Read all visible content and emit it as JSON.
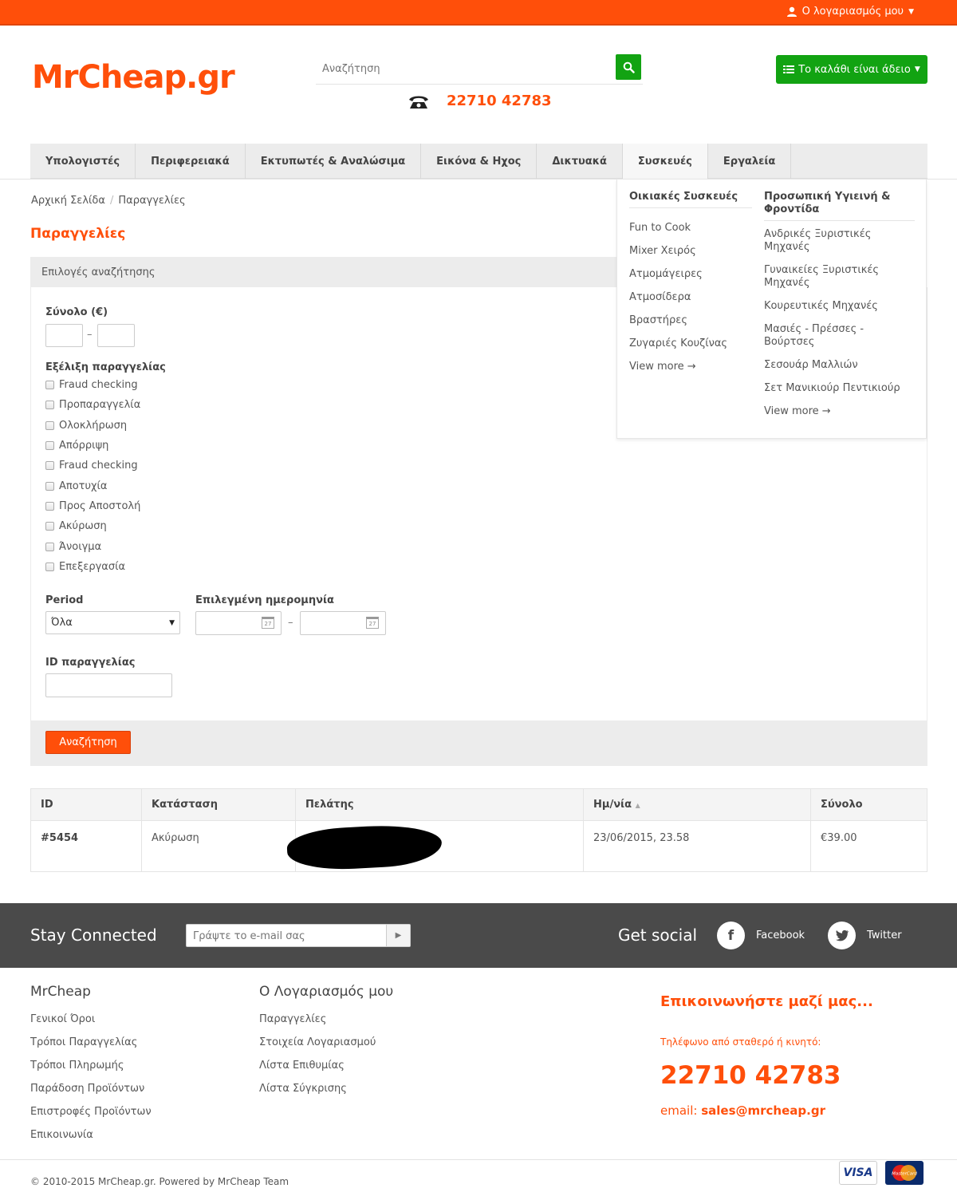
{
  "topbar": {
    "account_label": "Ο λογαριασμός μου"
  },
  "header": {
    "logo": "MrCheap.gr",
    "search_placeholder": "Αναζήτηση",
    "phone": "22710 42783",
    "cart_label": "Το καλάθι είναι άδειο"
  },
  "nav": {
    "items": [
      "Υπολογιστές",
      "Περιφερειακά",
      "Εκτυπωτές & Αναλώσιμα",
      "Εικόνα & Ηχος",
      "Δικτυακά",
      "Συσκευές",
      "Εργαλεία"
    ]
  },
  "dropdown": {
    "col1": {
      "heading": "Οικιακές Συσκευές",
      "links": [
        "Fun to Cook",
        "Mixer Χειρός",
        "Ατμομάγειρες",
        "Ατμοσίδερα",
        "Βραστήρες",
        "Ζυγαριές Κουζίνας"
      ],
      "more": "View more →"
    },
    "col2": {
      "heading": "Προσωπική Υγιεινή & Φροντίδα",
      "links": [
        "Ανδρικές Ξυριστικές Μηχανές",
        "Γυναικείες Ξυριστικές Μηχανές",
        "Κουρευτικές Μηχανές",
        "Μασιές - Πρέσσες - Βούρτσες",
        "Σεσουάρ Μαλλιών",
        "Σετ Μανικιούρ Πεντικιούρ"
      ],
      "more": "View more →"
    }
  },
  "breadcrumb": {
    "home": "Αρχική Σελίδα",
    "separator": "/",
    "current": "Παραγγελίες"
  },
  "page_title": "Παραγγελίες",
  "search_options": {
    "heading": "Επιλογές αναζήτησης",
    "total_label": "Σύνολο (€)",
    "range_sep": "–",
    "status_label": "Εξέλιξη παραγγελίας",
    "statuses": [
      "Fraud checking",
      "Προπαραγγελία",
      "Ολοκλήρωση",
      "Απόρριψη",
      "Fraud checking",
      "Αποτυχία",
      "Προς Αποστολή",
      "Ακύρωση",
      "Άνοιγμα",
      "Επεξεργασία"
    ],
    "period_label": "Period",
    "period_value": "Όλα",
    "date_label": "Επιλεγμένη ημερομηνία",
    "date_sep": "–",
    "calendar_day": "27",
    "order_id_label": "ID παραγγελίας",
    "submit_label": "Αναζήτηση"
  },
  "table": {
    "headers": [
      "ID",
      "Κατάσταση",
      "Πελάτης",
      "Ημ/νία",
      "Σύνολο"
    ],
    "sort_indicator": "▲",
    "rows": [
      {
        "id": "#5454",
        "status": "Ακύρωση",
        "customer": "",
        "date": "23/06/2015, 23.58",
        "total": "€39.00"
      }
    ]
  },
  "stay_connected": {
    "title": "Stay Connected",
    "email_placeholder": "Γράψτε το e-mail σας",
    "social_title": "Get social",
    "facebook": "Facebook",
    "twitter": "Twitter"
  },
  "footer": {
    "col1": {
      "heading": "MrCheap",
      "links": [
        "Γενικοί Όροι",
        "Τρόποι Παραγγελίας",
        "Τρόποι Πληρωμής",
        "Παράδοση Προϊόντων",
        "Επιστροφές Προϊόντων",
        "Επικοινωνία"
      ]
    },
    "col2": {
      "heading": "Ο Λογαριασμός μου",
      "links": [
        "Παραγγελίες",
        "Στοιχεία Λογαριασμού",
        "Λίστα Επιθυμίας",
        "Λίστα Σύγκρισης"
      ]
    },
    "contact": {
      "title": "Επικοινωνήστε μαζί μας...",
      "subtitle": "Τηλέφωνο από σταθερό ή κινητό:",
      "phone": "22710 42783",
      "email_label": "email:",
      "email": "sales@mrcheap.gr"
    },
    "copyright": "© 2010-2015 MrCheap.gr.  Powered by MrCheap Team",
    "visa": "VISA",
    "mastercard": "MasterCard"
  },
  "colors": {
    "brand": "#ff4f0a",
    "green": "#12a312",
    "dark_band": "#4a4a4a"
  }
}
